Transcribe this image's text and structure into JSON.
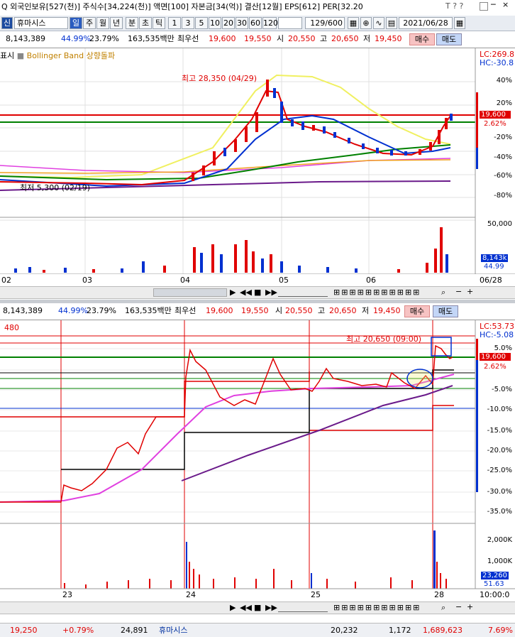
{
  "header": {
    "info_text": "Q 외국인보유[527(천)] 주식수[34,224(천)] 액면[100] 자본금[34(억)] 결산[12월] EPS[612] PER[32.20",
    "win_icons": [
      "□",
      "─",
      "□",
      "×"
    ]
  },
  "toolbar": {
    "mode": "신",
    "stock_name": "휴마시스",
    "periods": [
      "일",
      "주",
      "월",
      "년",
      "분",
      "초",
      "틱"
    ],
    "intervals": [
      "1",
      "3",
      "5",
      "10",
      "20",
      "30",
      "60",
      "120"
    ],
    "count": "129",
    "count_total": "/600",
    "date": "2021/06/28"
  },
  "quote_top": {
    "volume": "8,143,389",
    "rate1": "44.99%",
    "rate2": "23.79%",
    "amount": "163,535백만",
    "best_label": "최우선",
    "best_ask": "19,600",
    "best_bid": "19,550",
    "open_label": "시",
    "open": "20,550",
    "high_label": "고",
    "high": "20,650",
    "low_label": "저",
    "low": "19,450",
    "buy": "매수",
    "sell": "매도"
  },
  "chart_top": {
    "legend_prefix": "표시",
    "legend_item": "Bollinger Band 상향돌파",
    "max_label": "최고 28,350 (04/29)",
    "min_label": "최저 5,300 (02/19)",
    "lc": "LC:269.8",
    "hc": "HC:-30.8",
    "price_box": "19,600",
    "pct_box": "2.62%",
    "y_ticks": [
      "40%",
      "20%",
      "0%",
      "-20%",
      "-40%",
      "-60%",
      "-80%"
    ],
    "vol_max": "50,000",
    "vol_box": "8,143k",
    "vol_pct": "44.99",
    "x_ticks": [
      "02",
      "03",
      "04",
      "05",
      "06",
      "06/28"
    ]
  },
  "quote_bottom": {
    "volume": "8,143,389",
    "rate1": "44.99%",
    "rate2": "23.79%",
    "amount": "163,535백만",
    "best_label": "최우선",
    "best_ask": "19,600",
    "best_bid": "19,550",
    "open_label": "시",
    "open": "20,550",
    "high_label": "고",
    "high": "20,650",
    "low_label": "저",
    "low": "19,450",
    "buy": "매수",
    "sell": "매도"
  },
  "chart_bottom": {
    "top_label": "480",
    "max_label": "최고 20,650 (09:00)",
    "lc": "LC:53.73",
    "hc": "HC:-5.08",
    "price_box": "19,600",
    "pct_box": "2.62%",
    "y_ticks": [
      "5.0%",
      "-5.0%",
      "-10.0%",
      "-15.0%",
      "-20.0%",
      "-25.0%",
      "-30.0%",
      "-35.0%"
    ],
    "vol_ticks": [
      "2,000K",
      "1,000K"
    ],
    "vol_box": "23,260",
    "vol_pct": "51.63",
    "x_ticks": [
      "23",
      "24",
      "25",
      "28"
    ],
    "time": "10:00:0"
  },
  "bottom_row": {
    "left1": "19,250",
    "left2": "+0.79%",
    "left3": "24,891",
    "name": "휴마시스",
    "v1": "20,232",
    "v2": "1,172",
    "v3": "1,689,623",
    "v4": "7.69%"
  },
  "colors": {
    "red": "#e00000",
    "blue": "#0030d0",
    "green": "#008000",
    "magenta": "#e040e0",
    "purple": "#6a1a8a",
    "yellow": "#f0f060"
  }
}
